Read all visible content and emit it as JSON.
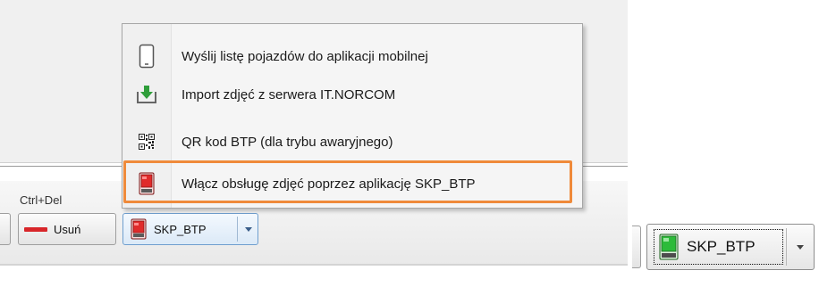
{
  "menu": {
    "items": [
      {
        "label": "Wyślij listę pojazdów do aplikacji mobilnej",
        "icon": "mobile-phone-icon"
      },
      {
        "label": "Import zdjęć z serwera IT.NORCOM",
        "icon": "import-download-icon"
      },
      {
        "label": "QR kod BTP (dla trybu awaryjnego)",
        "icon": "qr-code-icon"
      },
      {
        "label": "Włącz obsługę zdjęć poprzez aplikację SKP_BTP",
        "icon": "skp-red-device-icon"
      }
    ],
    "highlighted_item": "Włącz obsługę zdjęć poprzez aplikację SKP_BTP",
    "highlight_color": "#ef8a3a"
  },
  "toolbar": {
    "shortcut_label": "Ctrl+Del",
    "delete_label": "Usuń",
    "skp_label": "SKP_BTP",
    "delete_color": "#d8262a",
    "skp_icon_state": "red"
  },
  "right_crop": {
    "skp_label": "SKP_BTP",
    "skp_icon_state": "green"
  }
}
